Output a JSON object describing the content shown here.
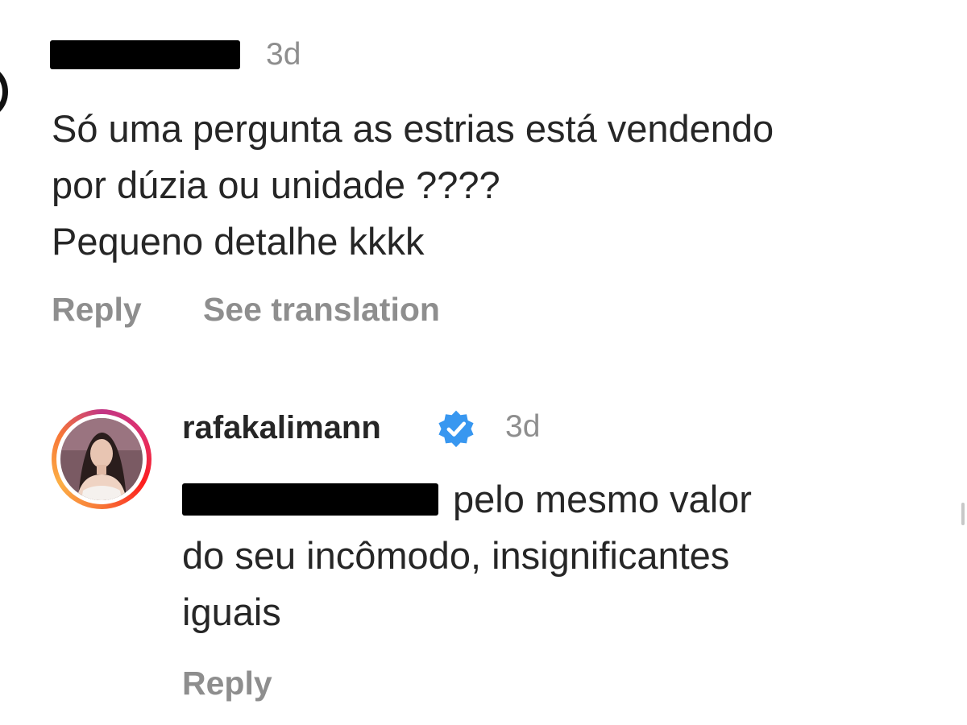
{
  "comment": {
    "timestamp": "3d",
    "text_lines": [
      "Só uma pergunta as estrias está vendendo",
      "por dúzia ou unidade ????",
      "Pequeno detalhe kkkk"
    ],
    "actions": {
      "reply": "Reply",
      "see_translation": "See translation"
    }
  },
  "reply_comment": {
    "username": "rafakalimann",
    "verified_icon": "verified-badge-icon",
    "timestamp": "3d",
    "text_lines": [
      "pelo mesmo valor",
      "do seu incômodo, insignificantes",
      "iguais"
    ],
    "actions": {
      "reply": "Reply"
    }
  },
  "colors": {
    "text": "#262626",
    "secondary": "#8e8e8e",
    "verified_blue": "#3897f0",
    "redaction": "#000000"
  }
}
